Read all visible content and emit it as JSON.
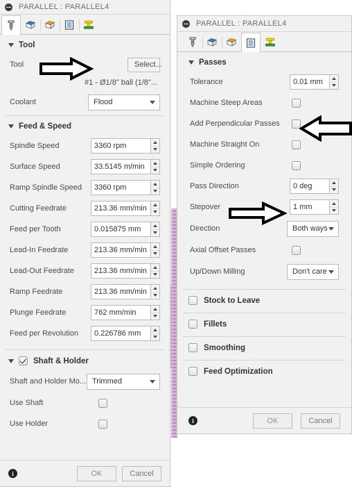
{
  "left_dialog": {
    "title": "PARALLEL : PARALLEL4",
    "collapse_icon": "minus-circle-icon",
    "tabs": [
      {
        "name": "tool-tab",
        "icon": "endmill-tool-icon",
        "selected": true
      },
      {
        "name": "geometry-tab",
        "icon": "blue-solid-box-icon",
        "selected": false
      },
      {
        "name": "heights-tab",
        "icon": "orange-top-box-icon",
        "selected": false
      },
      {
        "name": "passes-tab",
        "icon": "blue-passes-lines-icon",
        "selected": false
      },
      {
        "name": "linking-tab",
        "icon": "green-yellow-linking-icon",
        "selected": false
      }
    ],
    "sections": [
      {
        "name": "tool-section",
        "header": "Tool",
        "expanded": true,
        "rows": [
          {
            "type": "button",
            "label": "Tool",
            "value": "Select..."
          },
          {
            "type": "text",
            "label": "",
            "value": "#1 - Ø1/8\" ball (1/8\"..."
          },
          {
            "type": "combo",
            "label": "Coolant",
            "value": "Flood"
          }
        ]
      },
      {
        "name": "feed-and-speed-section",
        "header": "Feed & Speed",
        "expanded": true,
        "rows": [
          {
            "type": "spinner",
            "label": "Spindle Speed",
            "value": "3360 rpm"
          },
          {
            "type": "spinner",
            "label": "Surface Speed",
            "value": "33.5145 m/min"
          },
          {
            "type": "spinner",
            "label": "Ramp Spindle Speed",
            "value": "3360 rpm"
          },
          {
            "type": "spinner",
            "label": "Cutting Feedrate",
            "value": "213.36 mm/min"
          },
          {
            "type": "spinner",
            "label": "Feed per Tooth",
            "value": "0.015875 mm"
          },
          {
            "type": "spinner",
            "label": "Lead-In Feedrate",
            "value": "213.36 mm/min"
          },
          {
            "type": "spinner",
            "label": "Lead-Out Feedrate",
            "value": "213.36 mm/min"
          },
          {
            "type": "spinner",
            "label": "Ramp Feedrate",
            "value": "213.36 mm/min"
          },
          {
            "type": "spinner",
            "label": "Plunge Feedrate",
            "value": "762 mm/min"
          },
          {
            "type": "spinner",
            "label": "Feed per Revolution",
            "value": "0.226786 mm"
          }
        ]
      },
      {
        "name": "shaft-and-holder-section",
        "header": "Shaft & Holder",
        "expanded": true,
        "checked": true,
        "rows": [
          {
            "type": "combo",
            "label": "Shaft and Holder Mo...",
            "value": "Trimmed"
          },
          {
            "type": "checkbox",
            "label": "Use Shaft",
            "checked": false
          },
          {
            "type": "checkbox",
            "label": "Use Holder",
            "checked": false
          }
        ]
      }
    ],
    "footer": {
      "info_icon": "info-icon",
      "ok_label": "OK",
      "cancel_label": "Cancel"
    }
  },
  "right_dialog": {
    "title": "PARALLEL : PARALLEL4",
    "collapse_icon": "minus-circle-icon",
    "tabs": [
      {
        "name": "tool-tab",
        "icon": "endmill-tool-icon",
        "selected": false
      },
      {
        "name": "geometry-tab",
        "icon": "blue-solid-box-icon",
        "selected": false
      },
      {
        "name": "heights-tab",
        "icon": "orange-top-box-icon",
        "selected": false
      },
      {
        "name": "passes-tab",
        "icon": "blue-passes-lines-icon",
        "selected": true
      },
      {
        "name": "linking-tab",
        "icon": "green-yellow-linking-icon",
        "selected": false
      }
    ],
    "passes_section": {
      "name": "passes-section",
      "header": "Passes",
      "expanded": true,
      "rows": [
        {
          "type": "spinner",
          "label": "Tolerance",
          "value": "0.01 mm"
        },
        {
          "type": "checkbox",
          "label": "Machine Steep Areas",
          "checked": false
        },
        {
          "type": "checkbox",
          "label": "Add Perpendicular Passes",
          "checked": false
        },
        {
          "type": "checkbox",
          "label": "Machine Straight On",
          "checked": false
        },
        {
          "type": "checkbox",
          "label": "Simple Ordering",
          "checked": false
        },
        {
          "type": "spinner",
          "label": "Pass Direction",
          "value": "0 deg"
        },
        {
          "type": "spinner",
          "label": "Stepover",
          "value": "1 mm"
        },
        {
          "type": "combo",
          "label": "Direction",
          "value": "Both ways"
        },
        {
          "type": "checkbox",
          "label": "Axial Offset Passes",
          "checked": false
        },
        {
          "type": "combo",
          "label": "Up/Down Milling",
          "value": "Don't care"
        }
      ]
    },
    "collapsed_groups": [
      {
        "name": "stock-to-leave-group",
        "label": "Stock to Leave",
        "checked": false
      },
      {
        "name": "fillets-group",
        "label": "Fillets",
        "checked": false
      },
      {
        "name": "smoothing-group",
        "label": "Smoothing",
        "checked": false
      },
      {
        "name": "feed-optimization-group",
        "label": "Feed Optimization",
        "checked": false
      }
    ],
    "footer": {
      "info_icon": "info-icon",
      "ok_label": "OK",
      "cancel_label": "Cancel"
    }
  },
  "annotations": [
    {
      "name": "arrow-pointing-to-tool-select",
      "direction": "right",
      "target": "Select..."
    },
    {
      "name": "arrow-pointing-to-add-perpendicular-passes",
      "direction": "left",
      "target": "Add Perpendicular Passes"
    },
    {
      "name": "arrow-pointing-to-stepover",
      "direction": "right",
      "target": "Stepover"
    }
  ],
  "colors": {
    "dialog_bg": "#f1f1f1",
    "field_bg": "#ffffff",
    "border": "#c8c8c8",
    "text": "#3b3b3b",
    "title_text": "#6d6d6d",
    "viewport_pink": "#d9aed6",
    "tab_icon_blue": "#2f7fd0",
    "tab_icon_orange": "#f0a020",
    "tab_icon_green": "#35a02e",
    "tab_icon_yellow": "#f2e000",
    "annotation_arrow": "#000000"
  }
}
